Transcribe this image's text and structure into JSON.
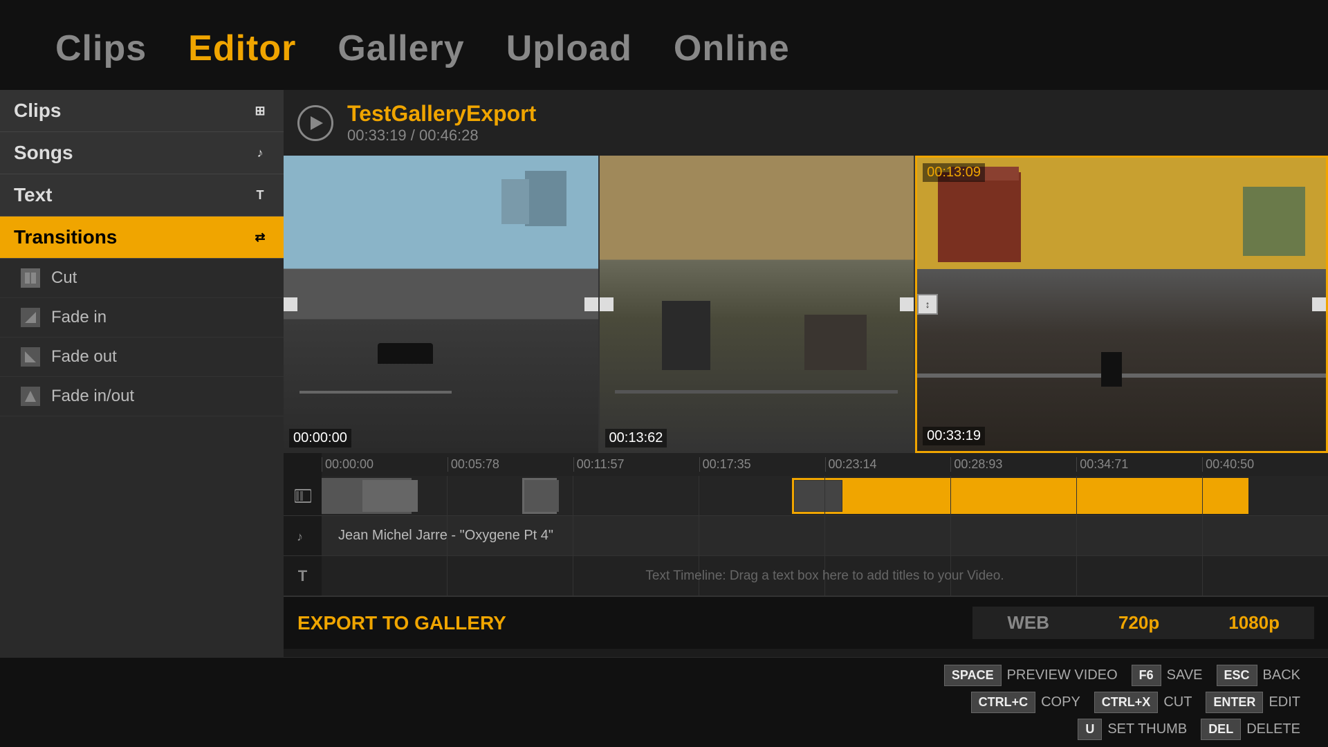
{
  "nav": {
    "items": [
      {
        "label": "Clips",
        "active": false
      },
      {
        "label": "Editor",
        "active": true
      },
      {
        "label": "Gallery",
        "active": false
      },
      {
        "label": "Upload",
        "active": false
      },
      {
        "label": "Online",
        "active": false
      }
    ]
  },
  "sidebar": {
    "items": [
      {
        "label": "Clips",
        "active": false,
        "icon": "grid"
      },
      {
        "label": "Songs",
        "active": false,
        "icon": "music"
      },
      {
        "label": "Text",
        "active": false,
        "icon": "T"
      },
      {
        "label": "Transitions",
        "active": true,
        "icon": "transitions"
      }
    ],
    "transitions": [
      {
        "label": "Cut"
      },
      {
        "label": "Fade in"
      },
      {
        "label": "Fade out"
      },
      {
        "label": "Fade in/out"
      }
    ]
  },
  "video": {
    "title": "TestGalleryExport",
    "current_time": "00:33:19",
    "total_time": "00:46:28"
  },
  "preview": {
    "clips": [
      {
        "time_label": "00:00:00"
      },
      {
        "time_label": "00:13:62"
      },
      {
        "time_top": "00:13:09",
        "time_label": "00:33:19"
      }
    ]
  },
  "timeline": {
    "ruler_marks": [
      "00:00:00",
      "00:05:78",
      "00:11:57",
      "00:17:35",
      "00:23:14",
      "00:28:93",
      "00:34:71",
      "00:40:50"
    ],
    "music_label": "Jean Michel Jarre  - \"Oxygene Pt 4\"",
    "text_hint": "Text Timeline:  Drag a text box here to add titles to your Video."
  },
  "export": {
    "label": "EXPORT TO GALLERY",
    "qualities": [
      "WEB",
      "720p",
      "1080p"
    ]
  },
  "shortcuts": {
    "row1": [
      {
        "key": "SPACE",
        "label": "PREVIEW VIDEO"
      },
      {
        "key": "F6",
        "label": "SAVE"
      },
      {
        "key": "ESC",
        "label": "BACK"
      }
    ],
    "row2": [
      {
        "key": "CTRL+C",
        "label": "COPY"
      },
      {
        "key": "CTRL+X",
        "label": "CUT"
      },
      {
        "key": "ENTER",
        "label": "EDIT"
      }
    ],
    "row3": [
      {
        "key": "U",
        "label": "SET THUMB"
      },
      {
        "key": "DEL",
        "label": "DELETE"
      }
    ]
  }
}
